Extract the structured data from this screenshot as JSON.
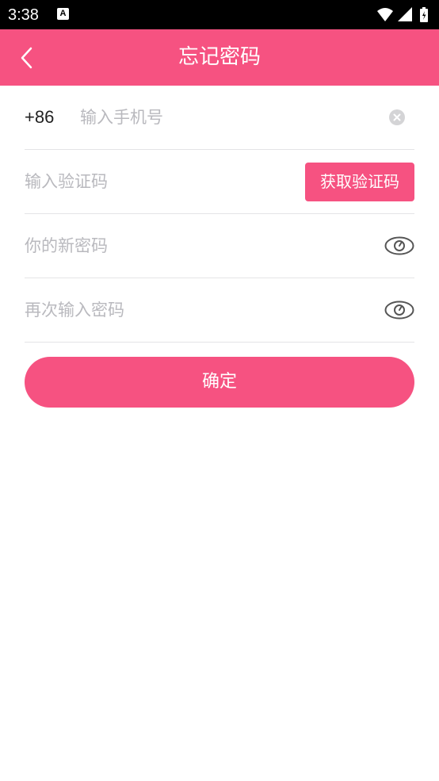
{
  "status_bar": {
    "time": "3:38",
    "notification_icon": "A",
    "icons": [
      "wifi-icon",
      "signal-icon",
      "battery-icon"
    ]
  },
  "app_bar": {
    "back_icon": "chevron-left-icon",
    "title": "忘记密码",
    "color": "#f65281"
  },
  "form": {
    "phone": {
      "prefix": "+86",
      "placeholder": "输入手机号",
      "value": "",
      "clear_icon": "clear-circle-icon"
    },
    "code": {
      "placeholder": "输入验证码",
      "value": "",
      "button_label": "获取验证码"
    },
    "new_password": {
      "placeholder": "你的新密码",
      "value": "",
      "toggle_icon": "eye-icon"
    },
    "confirm_password": {
      "placeholder": "再次输入密码",
      "value": "",
      "toggle_icon": "eye-icon"
    }
  },
  "confirm_button": {
    "label": "确定"
  }
}
